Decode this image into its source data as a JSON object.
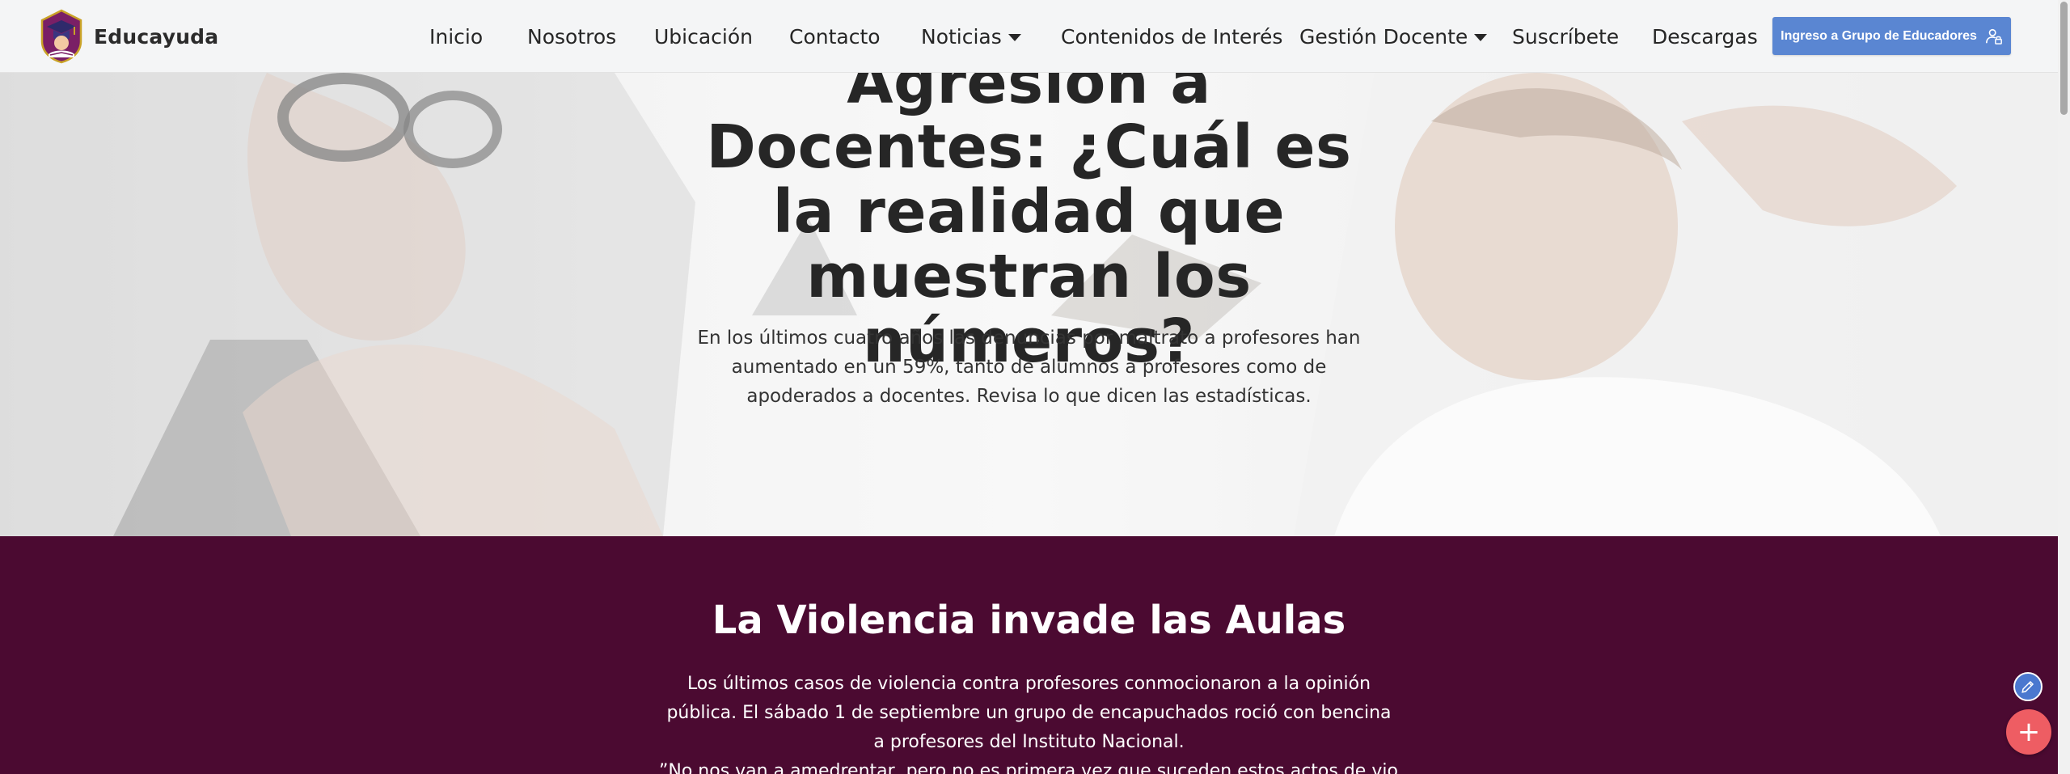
{
  "header": {
    "brand_name": "Educayuda",
    "nav": {
      "inicio": "Inicio",
      "nosotros": "Nosotros",
      "ubicacion": "Ubicación",
      "contacto": "Contacto",
      "noticias": "Noticias",
      "contenidos": "Contenidos de Interés",
      "gestion": "Gestión Docente",
      "suscribete": "Suscríbete",
      "descargas": "Descargas"
    },
    "cta_label": "Ingreso a Grupo de Educadores",
    "cta_icon": "user-lock-icon"
  },
  "hero": {
    "title": "Agresión a Docentes: ¿Cuál es la realidad que muestran los números?",
    "subtitle": "En los últimos cuatro años las denuncias por maltrato a profesores han aumentado en un 59%, tanto de alumnos a profesores como de apoderados a docentes. Revisa lo que dicen las estadísticas."
  },
  "section": {
    "title": "La Violencia invade las Aulas",
    "text": "Los últimos casos de violencia contra profesores conmocionaron a la opinión pública. El sábado 1 de septiembre un grupo de encapuchados roció con bencina a profesores del Instituto Nacional.",
    "quote": "”No nos van a amedrentar, pero no es primera vez que suceden estos actos de violencia"
  },
  "floating": {
    "edit_icon": "pencil-icon",
    "add_symbol": "+"
  },
  "colors": {
    "accent": "#5a86d2",
    "section_bg": "#4b0a31",
    "fab_add": "#ee5d63",
    "fab_edit": "#4a78cf"
  }
}
